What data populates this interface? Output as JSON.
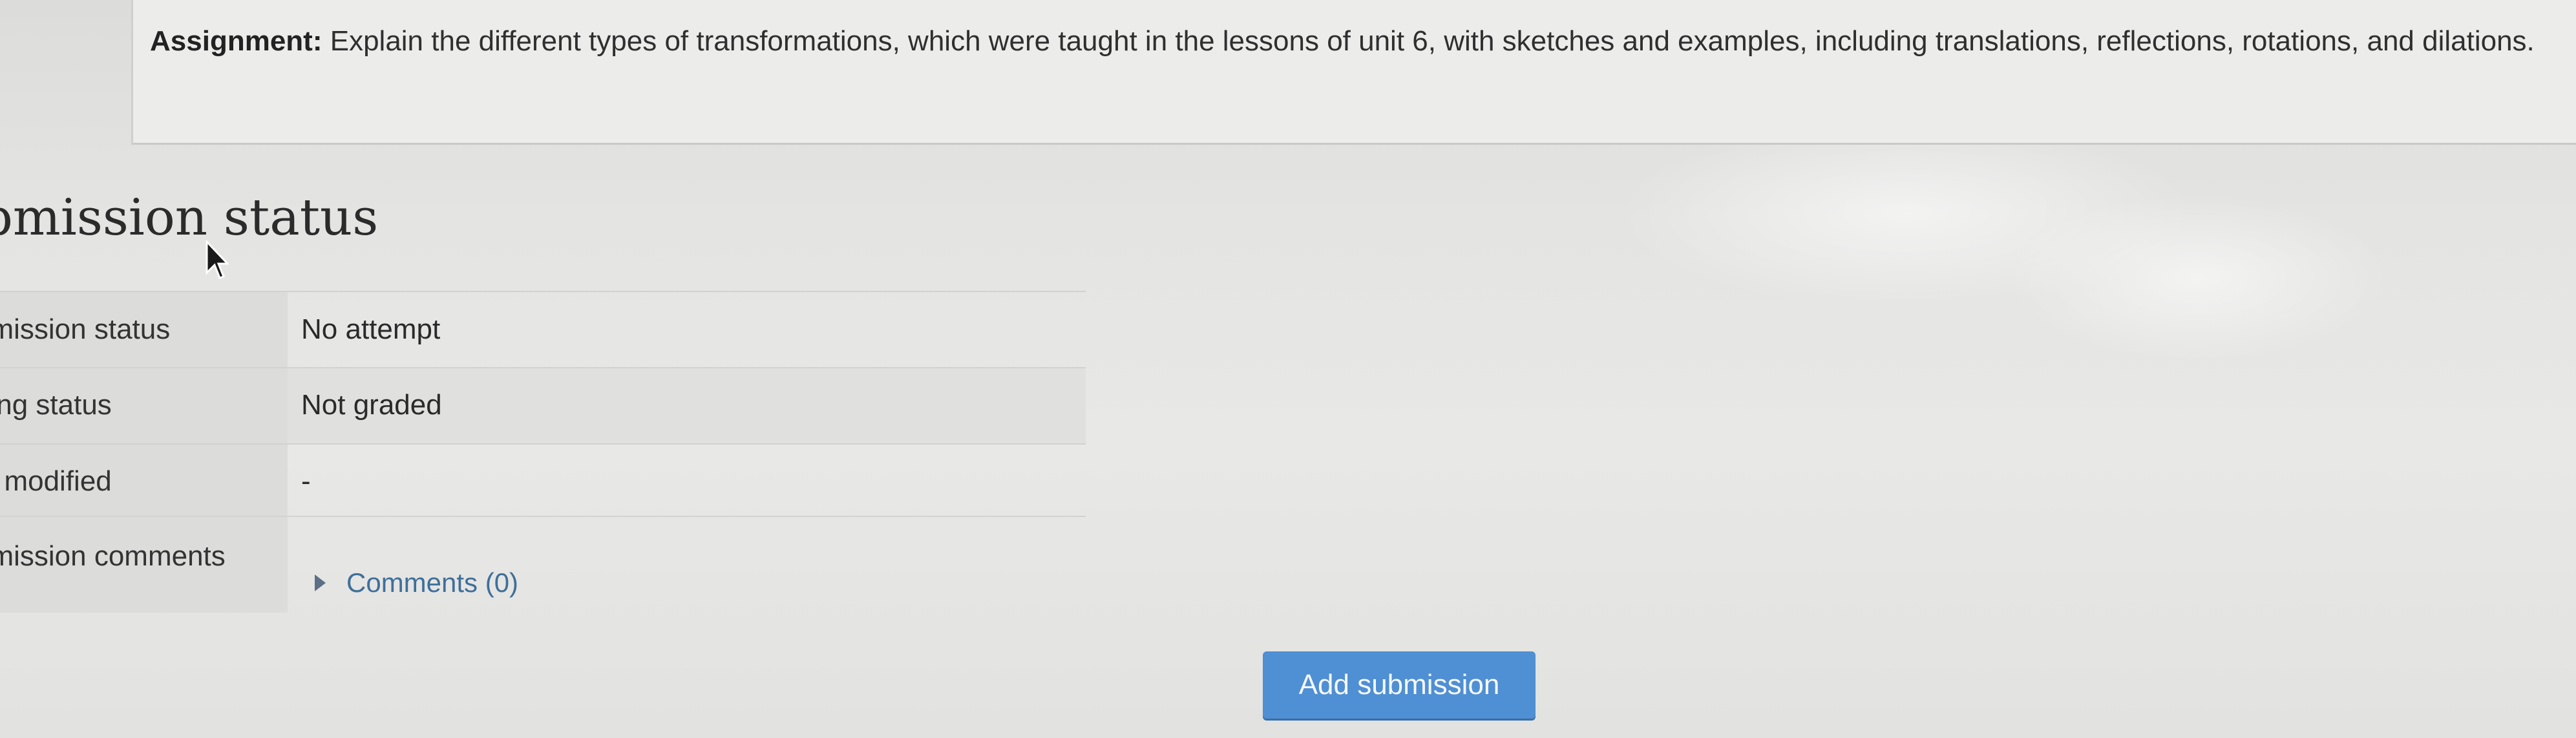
{
  "assignment": {
    "label": "Assignment:",
    "text": "Explain the different types of transformations, which were taught in the lessons of unit 6, with sketches and examples, including translations, reflections, rotations, and dilations."
  },
  "submission": {
    "heading": "bmission status",
    "rows": [
      {
        "label": "omission status",
        "value": "No attempt"
      },
      {
        "label": "ding status",
        "value": "Not graded"
      },
      {
        "label": "st modified",
        "value": "-"
      },
      {
        "label": "bmission comments",
        "value": ""
      }
    ],
    "comments_link": "Comments (0)",
    "add_button": "Add submission"
  },
  "icons": {
    "comments_toggle": "caret-right-icon",
    "pointer": "mouse-cursor-icon"
  },
  "colors": {
    "button": "#4f8fd3",
    "link": "#3f6f9a"
  }
}
